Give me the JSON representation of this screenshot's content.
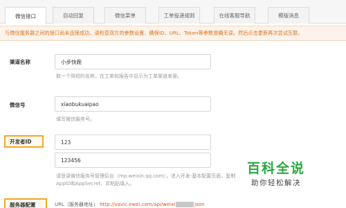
{
  "tabs": [
    {
      "label": "微信接口",
      "active": true
    },
    {
      "label": "自动回复",
      "active": false
    },
    {
      "label": "微信菜单",
      "active": false
    },
    {
      "label": "工单投递规则",
      "active": false
    },
    {
      "label": "在线客服导航",
      "active": false
    },
    {
      "label": "模版消息",
      "active": false
    }
  ],
  "notice": "与微信服务器之间的接口尚未连接成功，请检查双方的参数设置，确保ID、URL、Token等参数准确无误。然后点击更新再次尝试互联。",
  "form": {
    "channel_name": {
      "label": "渠道名称",
      "value": "小步快跑",
      "hint": "取一个简短的名称，在工单和报告中显示为工单渠道来源。"
    },
    "wechat_id": {
      "label": "微信号",
      "value": "xiaobukuaipao",
      "hint": "填写微信服务号。"
    },
    "developer_id": {
      "label": "开发者ID",
      "app_id": "123",
      "app_secret": "123456",
      "hint_line1": "请登录微信服务号管理后台（mp.weixin.qq.com），进入开发-基本配置页面，复制",
      "hint_line2": "AppID和AppSecret，并粘贴填入。"
    },
    "server_config": {
      "label": "服务器配置",
      "url_label": "URL（服务器地址）",
      "url_value_start": "http://vavic.ewei.com/api/weixi",
      "url_value_end": "json"
    }
  },
  "watermark": {
    "main": "百科全说",
    "sub": "助你轻松解决",
    "color": "#2aa843"
  },
  "colors": {
    "notice_text": "#d9731f",
    "highlight_border": "#f5a623",
    "url": "#d9531f"
  }
}
